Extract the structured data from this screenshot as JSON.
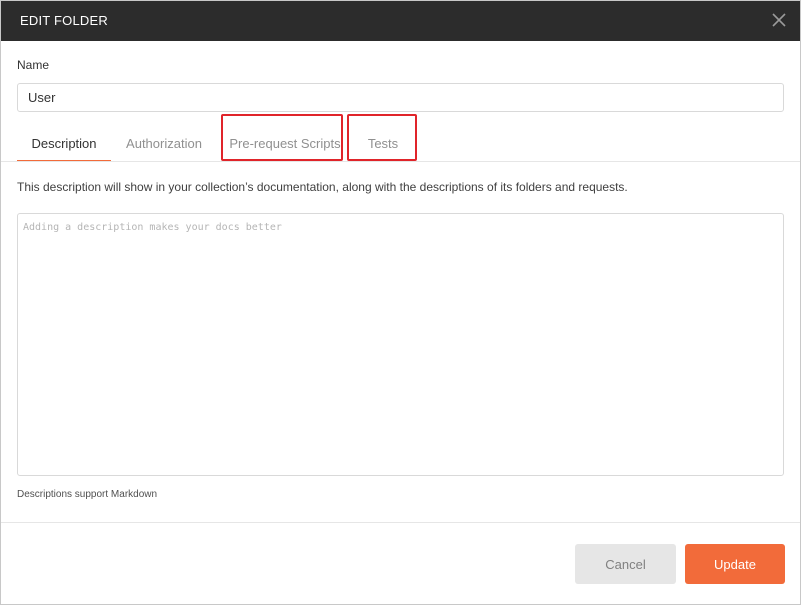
{
  "dialog": {
    "title": "EDIT FOLDER",
    "close_icon": "close-icon"
  },
  "name_field": {
    "label": "Name",
    "value": "User"
  },
  "tabs": [
    {
      "label": "Description",
      "active": true
    },
    {
      "label": "Authorization",
      "active": false
    },
    {
      "label": "Pre-request Scripts",
      "active": false,
      "highlighted": true
    },
    {
      "label": "Tests",
      "active": false,
      "highlighted": true
    }
  ],
  "description": {
    "info": "This description will show in your collection’s documentation, along with the descriptions of its folders and requests.",
    "placeholder": "Adding a description makes your docs better",
    "markdown_note": "Descriptions support Markdown"
  },
  "footer": {
    "cancel_label": "Cancel",
    "update_label": "Update"
  },
  "colors": {
    "title_bar": "#2c2c2c",
    "accent": "#f26b3a",
    "highlight_box": "#e0242a"
  }
}
